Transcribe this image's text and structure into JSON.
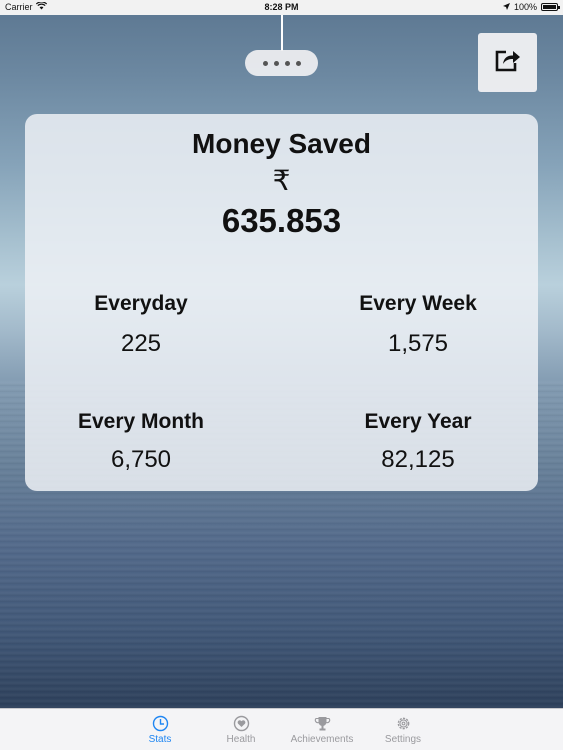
{
  "status_bar": {
    "carrier": "Carrier",
    "time": "8:28 PM",
    "battery": "100%"
  },
  "page_indicator": {
    "dot_count": 4
  },
  "share_button": {
    "icon": "share-icon"
  },
  "card": {
    "title": "Money Saved",
    "currency_symbol": "₹",
    "total": "635.853",
    "stats": {
      "day": {
        "label": "Everyday",
        "value": "225"
      },
      "week": {
        "label": "Every Week",
        "value": "1,575"
      },
      "month": {
        "label": "Every Month",
        "value": "6,750"
      },
      "year": {
        "label": "Every Year",
        "value": "82,125"
      }
    }
  },
  "tab_bar": {
    "tabs": [
      {
        "label": "Stats",
        "icon": "clock-icon",
        "active": true
      },
      {
        "label": "Health",
        "icon": "heart-icon",
        "active": false
      },
      {
        "label": "Achievements",
        "icon": "trophy-icon",
        "active": false
      },
      {
        "label": "Settings",
        "icon": "gear-icon",
        "active": false
      }
    ]
  },
  "colors": {
    "accent": "#1f86f2",
    "tab_inactive": "#9a9a9e"
  }
}
